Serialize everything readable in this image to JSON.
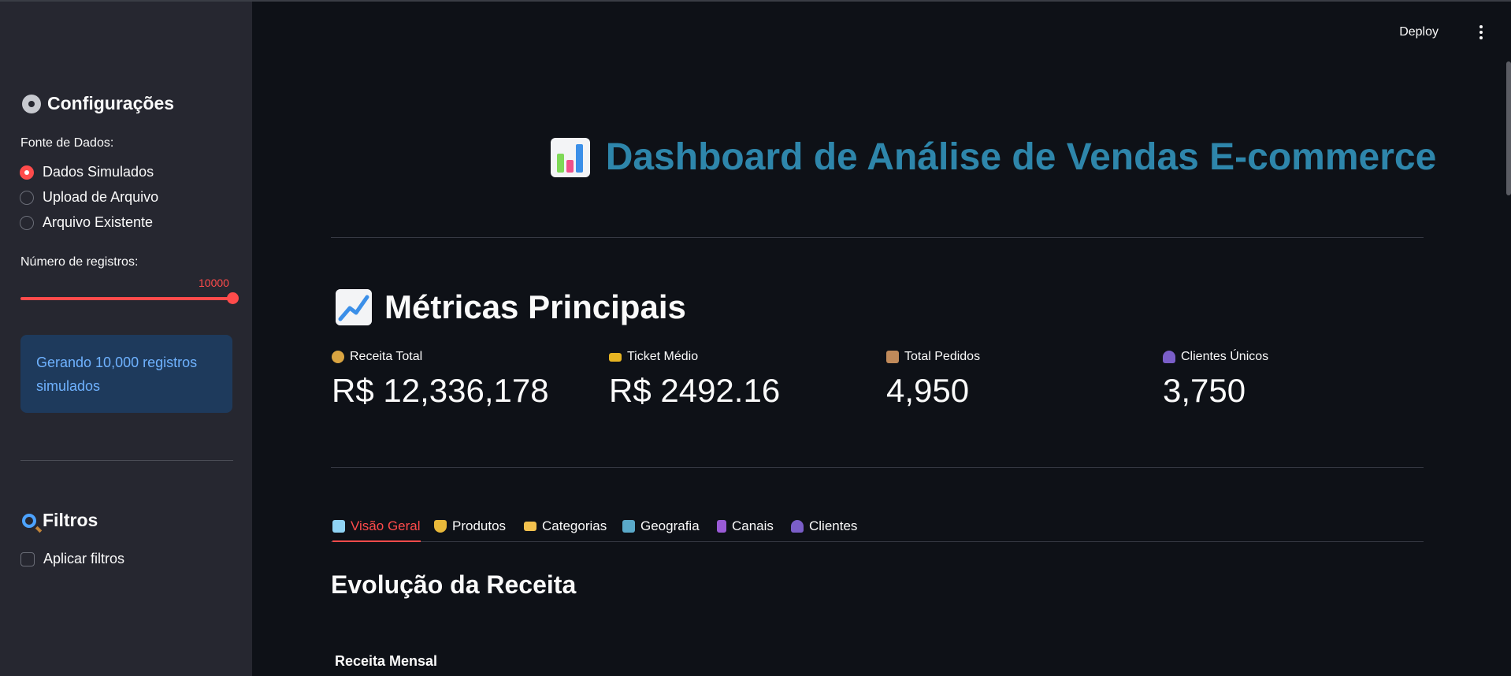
{
  "sidebar": {
    "config_title": "Configurações",
    "data_source_label": "Fonte de Dados:",
    "data_source_options": [
      "Dados Simulados",
      "Upload de Arquivo",
      "Arquivo Existente"
    ],
    "data_source_selected": "Dados Simulados",
    "records_label": "Número de registros:",
    "records_value": "10000",
    "records_fraction": 1.0,
    "info_message": "Gerando 10,000 registros simulados",
    "filters_title": "Filtros",
    "apply_filters_label": "Aplicar filtros",
    "apply_filters_checked": false
  },
  "header": {
    "deploy_label": "Deploy"
  },
  "main": {
    "title": "Dashboard de Análise de Vendas E-commerce",
    "metrics_title": "Métricas Principais",
    "metrics": [
      {
        "icon": "money-bag-icon",
        "label": "Receita Total",
        "value": "R$ 12,336,178"
      },
      {
        "icon": "ticket-icon",
        "label": "Ticket Médio",
        "value": "R$ 2492.16"
      },
      {
        "icon": "package-icon",
        "label": "Total Pedidos",
        "value": "4,950"
      },
      {
        "icon": "people-icon",
        "label": "Clientes Únicos",
        "value": "3,750"
      }
    ],
    "tabs": [
      {
        "icon": "bar-chart-icon",
        "label": "Visão Geral",
        "active": true
      },
      {
        "icon": "trophy-icon",
        "label": "Produtos"
      },
      {
        "icon": "folder-icon",
        "label": "Categorias"
      },
      {
        "icon": "map-icon",
        "label": "Geografia"
      },
      {
        "icon": "abacus-icon",
        "label": "Canais"
      },
      {
        "icon": "people-icon",
        "label": "Clientes"
      }
    ],
    "section_title": "Evolução da Receita",
    "chart_title": "Receita Mensal"
  },
  "colors": {
    "accent": "#ff4b4b",
    "title": "#2e86ab",
    "info_bg": "#1e3a5c",
    "info_text": "#6fb2ff",
    "sidebar_bg": "#262730",
    "main_bg": "#0e1117"
  }
}
